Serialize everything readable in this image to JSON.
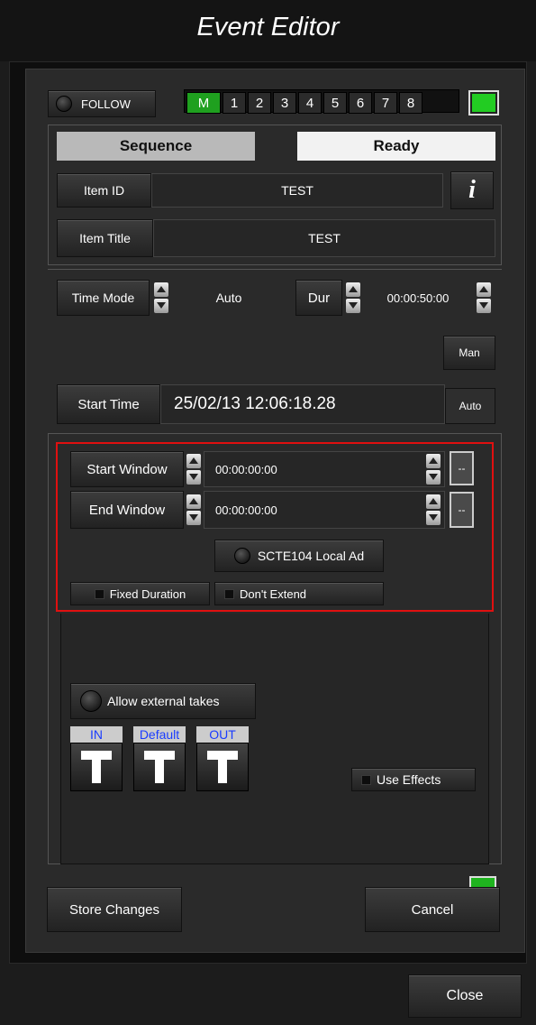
{
  "window": {
    "title": "Event Editor"
  },
  "toolbar": {
    "follow_label": "FOLLOW",
    "channels": [
      "M",
      "1",
      "2",
      "3",
      "4",
      "5",
      "6",
      "7",
      "8"
    ],
    "status_color": "#22cc22"
  },
  "status": {
    "sequence_label": "Sequence",
    "state": "Ready"
  },
  "item": {
    "id_label": "Item ID",
    "id_value": "TEST",
    "title_label": "Item Title",
    "title_value": "TEST",
    "info_icon": "i"
  },
  "timing": {
    "time_mode_label": "Time Mode",
    "time_mode_value": "Auto",
    "dur_label": "Dur",
    "dur_value": "00:00:50:00",
    "man_label": "Man",
    "start_time_label": "Start Time",
    "start_time_value": "25/02/13 12:06:18.28",
    "auto_label": "Auto"
  },
  "window_section": {
    "start_window_label": "Start Window",
    "start_window_value": "00:00:00:00",
    "end_window_label": "End Window",
    "end_window_value": "00:00:00:00",
    "toggle_label": "--",
    "scte_label": "SCTE104 Local Ad",
    "fixed_duration_label": "Fixed Duration",
    "dont_extend_label": "Don't Extend",
    "highlight_color": "#e01010"
  },
  "takes": {
    "allow_external_label": "Allow external takes",
    "buttons": [
      "IN",
      "Default",
      "OUT"
    ],
    "use_effects_label": "Use Effects"
  },
  "footer": {
    "store_label": "Store Changes",
    "cancel_label": "Cancel",
    "close_label": "Close"
  }
}
